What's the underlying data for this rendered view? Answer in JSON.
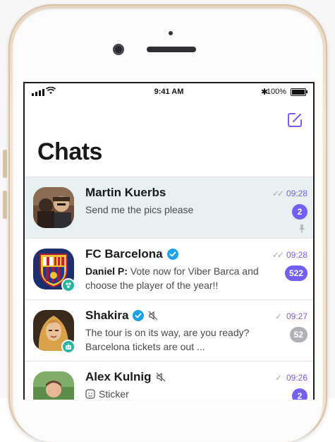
{
  "statusbar": {
    "time": "9:41 AM",
    "battery": "100%"
  },
  "header": {
    "title": "Chats"
  },
  "colors": {
    "accent": "#7360f2",
    "selected_row": "#e8f0f2",
    "muted_badge": "#b0b0b6",
    "verified": "#1ea1e6",
    "bot_badge": "#2bb3a4"
  },
  "chats": [
    {
      "name": "Martin Kuerbs",
      "message": "Send me the pics please",
      "time": "09:28",
      "unread": "2",
      "read_ticks": "double",
      "pinned": true,
      "selected": true
    },
    {
      "name": "FC Barcelona",
      "verified": true,
      "sender": "Daniel P:",
      "message": "Vote now for Viber Barca and choose the player of the year!!",
      "time": "09:28",
      "unread": "522",
      "read_ticks": "double"
    },
    {
      "name": "Shakira",
      "verified": true,
      "muted": true,
      "message": "The tour is on its way, are you ready? Barcelona tickets are out ...",
      "time": "09:27",
      "unread": "52",
      "unread_muted": true,
      "read_ticks": "single"
    },
    {
      "name": "Alex Kulnig",
      "muted": true,
      "message": "Sticker",
      "time": "09:26",
      "unread": "2",
      "read_ticks": "single"
    }
  ]
}
